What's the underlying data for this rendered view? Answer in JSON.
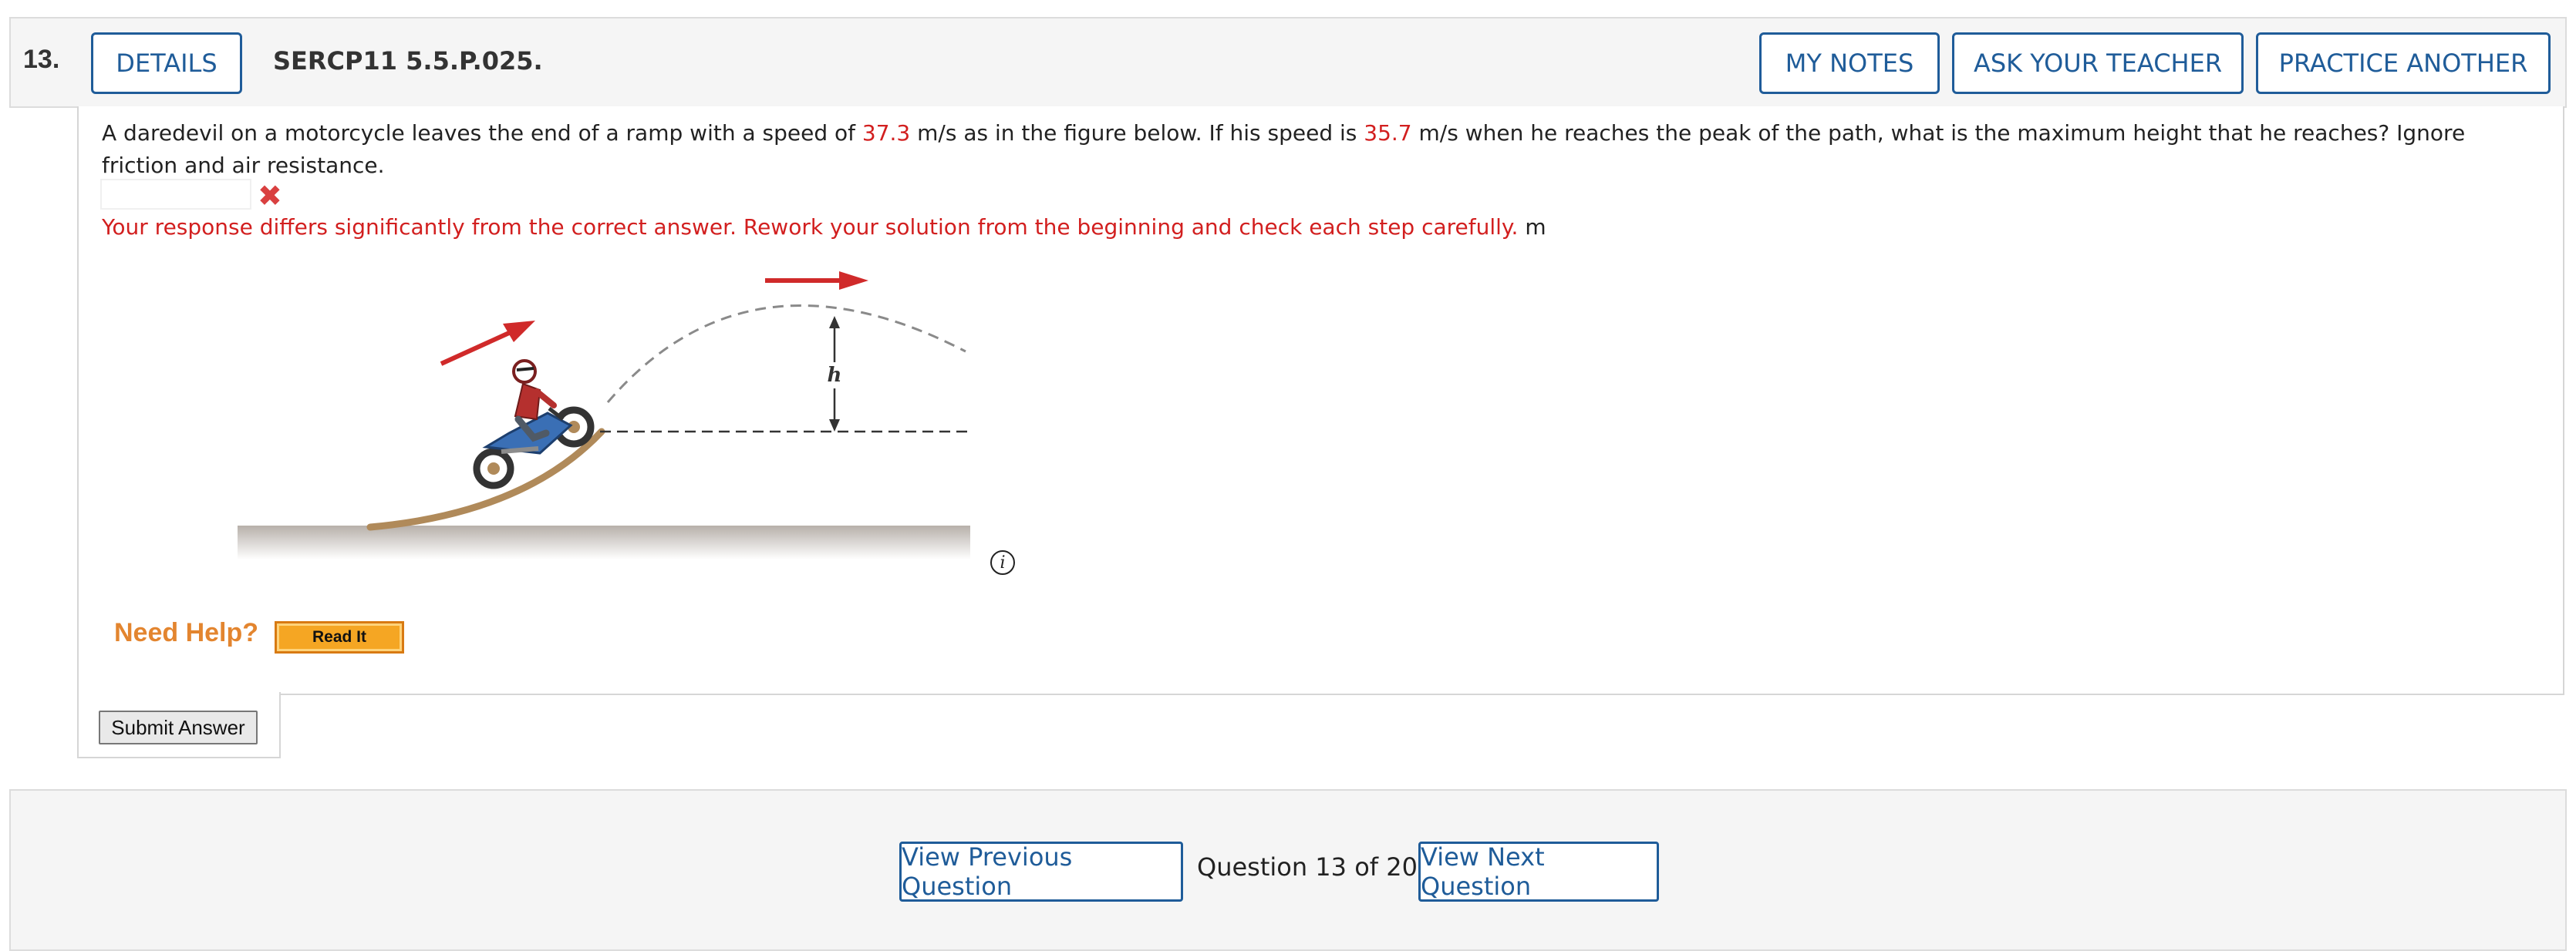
{
  "header": {
    "question_number": "13.",
    "details_label": "DETAILS",
    "problem_id": "SERCP11 5.5.P.025.",
    "my_notes_label": "MY NOTES",
    "ask_teacher_label": "ASK YOUR TEACHER",
    "practice_another_label": "PRACTICE ANOTHER"
  },
  "question": {
    "text_1": "A daredevil on a motorcycle leaves the end of a ramp with a speed of ",
    "speed_1": "37.3",
    "text_2": " m/s as in the figure below. If his speed is ",
    "speed_2": "35.7",
    "text_3": " m/s when he reaches the peak of the path, what is the maximum height that he reaches? Ignore friction and air resistance."
  },
  "answer": {
    "value": "",
    "status_icon": "x-mark-icon",
    "feedback": "Your response differs significantly from the correct answer. Rework your solution from the beginning and check each step carefully.",
    "unit": "m"
  },
  "figure": {
    "height_label": "h",
    "info_symbol": "i"
  },
  "help": {
    "need_help_label": "Need Help?",
    "read_it_label": "Read It"
  },
  "submit_label": "Submit Answer",
  "footer": {
    "prev_label": "View Previous Question",
    "counter": "Question 13 of 20",
    "next_label": "View Next Question"
  },
  "colors": {
    "accent_blue": "#1f5c99",
    "error_red": "#d21f1f",
    "help_orange": "#e3852f"
  }
}
